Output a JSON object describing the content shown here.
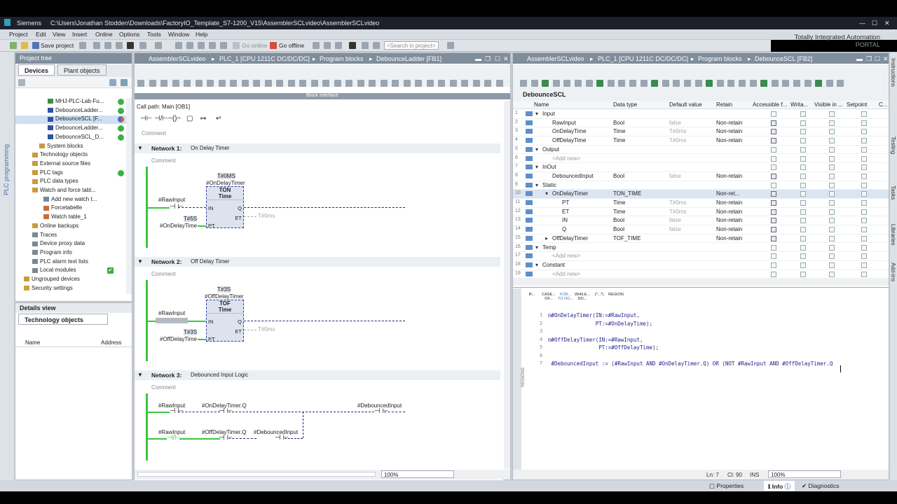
{
  "window": {
    "app": "Siemens",
    "path": "C:\\Users\\Jonathan Stodden\\Downloads\\FactoryIO_Template_S7-1200_V15\\AssemblerSCLvideo\\AssemblerSCLvideo"
  },
  "menu": [
    "Project",
    "Edit",
    "View",
    "Insert",
    "Online",
    "Options",
    "Tools",
    "Window",
    "Help"
  ],
  "toolbar": {
    "save": "Save project",
    "go_online": "Go online",
    "go_offline": "Go offline",
    "search_placeholder": "<Search in project>"
  },
  "brand": {
    "line1": "Totally Integrated Automation",
    "line2": "PORTAL"
  },
  "sidebar_left": "PLC programming",
  "project_tree": {
    "title": "Project tree",
    "tabs": [
      "Devices",
      "Plant objects"
    ],
    "items": [
      {
        "label": "MHJ-PLC-Lab-Fu...",
        "status": "green"
      },
      {
        "label": "DebounceLadder...",
        "status": "green"
      },
      {
        "label": "DebounceSCL [F...",
        "status": "half"
      },
      {
        "label": "DebounceLadder...",
        "status": "green"
      },
      {
        "label": "DebounceSCL_D...",
        "status": "green"
      },
      {
        "label": "System blocks",
        "status": ""
      },
      {
        "label": "Technology objects",
        "status": ""
      },
      {
        "label": "External source files",
        "status": ""
      },
      {
        "label": "PLC tags",
        "status": "green"
      },
      {
        "label": "PLC data types",
        "status": ""
      },
      {
        "label": "Watch and force tabl...",
        "status": ""
      },
      {
        "label": "Add new watch t...",
        "status": ""
      },
      {
        "label": "Forcetabelle",
        "status": ""
      },
      {
        "label": "Watch table_1",
        "status": ""
      },
      {
        "label": "Online backups",
        "status": ""
      },
      {
        "label": "Traces",
        "status": ""
      },
      {
        "label": "Device proxy data",
        "status": ""
      },
      {
        "label": "Program info",
        "status": ""
      },
      {
        "label": "PLC alarm text lists",
        "status": ""
      },
      {
        "label": "Local modules",
        "status": "check"
      },
      {
        "label": "Ungrouped devices",
        "status": ""
      },
      {
        "label": "Security settings",
        "status": ""
      }
    ]
  },
  "details": {
    "title": "Details view",
    "tab": "Technology objects",
    "col_name": "Name",
    "col_address": "Address"
  },
  "ladder": {
    "breadcrumb": [
      "AssemblerSCLvideo",
      "PLC_1 [CPU 1211C DC/DC/DC]",
      "Program blocks",
      "DebounceLadder [FB1]"
    ],
    "block_interface": "Block interface",
    "call_path": "Call path: Main [OB1]",
    "comment": "Comment",
    "networks": [
      {
        "title": "Network 1:",
        "desc": "On Delay Timer",
        "timer_value": "T#0MS",
        "timer_name": "#OnDelayTimer",
        "type": "TON",
        "sub": "Time",
        "in_contact": "#RawInput",
        "pt_value": "T#5S",
        "pt_tag": "#OnDelayTime",
        "et": "T#0ms",
        "pins": [
          "IN",
          "Q",
          "PT",
          "ET"
        ]
      },
      {
        "title": "Network 2:",
        "desc": "Off Delay Timer",
        "timer_value": "T#3S",
        "timer_name": "#OffDelayTimer",
        "type": "TOF",
        "sub": "Time",
        "in_contact": "#RawInput",
        "pt_value": "T#3S",
        "pt_tag": "#OffDelayTime",
        "et": "T#0ms",
        "pins": [
          "IN",
          "Q",
          "PT",
          "ET"
        ]
      },
      {
        "title": "Network 3:",
        "desc": "Debounced Input Logic",
        "r1": [
          "#RawInput",
          "#OnDelayTimer.Q",
          "#DebouncedInput"
        ],
        "r2": [
          "#RawInput",
          "#OffDelayTimer.Q",
          "#DebouncedInput"
        ]
      }
    ],
    "zoom": "100%"
  },
  "scl": {
    "breadcrumb": [
      "AssemblerSCLvideo",
      "PLC_1 [CPU 1211C DC/DC/DC]",
      "Program blocks",
      "DebounceSCL [FB2]"
    ],
    "block": "DebounceSCL",
    "columns": [
      "Name",
      "Data type",
      "Default value",
      "Retain",
      "Accessible f...",
      "Writa...",
      "Visible in ...",
      "Setpoint",
      "C..."
    ],
    "rows": [
      {
        "n": "1",
        "name": "Input",
        "type": "",
        "def": "",
        "ret": "",
        "lvl": 0,
        "grp": true
      },
      {
        "n": "2",
        "name": "RawInput",
        "type": "Bool",
        "def": "false",
        "ret": "Non-retain",
        "lvl": 1
      },
      {
        "n": "3",
        "name": "OnDelayTime",
        "type": "Time",
        "def": "T#0ms",
        "ret": "Non-retain",
        "lvl": 1
      },
      {
        "n": "4",
        "name": "OffDelayTime",
        "type": "Time",
        "def": "T#0ms",
        "ret": "Non-retain",
        "lvl": 1
      },
      {
        "n": "5",
        "name": "Output",
        "type": "",
        "def": "",
        "ret": "",
        "lvl": 0,
        "grp": true
      },
      {
        "n": "6",
        "name": "<Add new>",
        "type": "",
        "def": "",
        "ret": "",
        "lvl": 1,
        "add": true
      },
      {
        "n": "7",
        "name": "InOut",
        "type": "",
        "def": "",
        "ret": "",
        "lvl": 0,
        "grp": true
      },
      {
        "n": "8",
        "name": "DebouncedInput",
        "type": "Bool",
        "def": "false",
        "ret": "Non-retain",
        "lvl": 1
      },
      {
        "n": "9",
        "name": "Static",
        "type": "",
        "def": "",
        "ret": "",
        "lvl": 0,
        "grp": true
      },
      {
        "n": "10",
        "name": "OnDelayTimer",
        "type": "TON_TIME",
        "def": "",
        "ret": "Non-ret...",
        "lvl": 1,
        "sel": true
      },
      {
        "n": "11",
        "name": "PT",
        "type": "Time",
        "def": "T#0ms",
        "ret": "Non-retain",
        "lvl": 2
      },
      {
        "n": "12",
        "name": "ET",
        "type": "Time",
        "def": "T#0ms",
        "ret": "Non-retain",
        "lvl": 2
      },
      {
        "n": "13",
        "name": "IN",
        "type": "Bool",
        "def": "false",
        "ret": "Non-retain",
        "lvl": 2
      },
      {
        "n": "14",
        "name": "Q",
        "type": "Bool",
        "def": "false",
        "ret": "Non-retain",
        "lvl": 2
      },
      {
        "n": "15",
        "name": "OffDelayTimer",
        "type": "TOF_TIME",
        "def": "",
        "ret": "Non-retain",
        "lvl": 1
      },
      {
        "n": "16",
        "name": "Temp",
        "type": "",
        "def": "",
        "ret": "",
        "lvl": 0,
        "grp": true
      },
      {
        "n": "17",
        "name": "<Add new>",
        "type": "",
        "def": "",
        "ret": "",
        "lvl": 1,
        "add": true
      },
      {
        "n": "18",
        "name": "Constant",
        "type": "",
        "def": "",
        "ret": "",
        "lvl": 0,
        "grp": true
      },
      {
        "n": "19",
        "name": "<Add new>",
        "type": "",
        "def": "",
        "ret": "",
        "lvl": 1,
        "add": true
      }
    ],
    "instr_tabs": [
      "IF...",
      "CASE... OF...",
      "FOR... TO DO...",
      "WHILE... DO...",
      "(*...*)",
      "REGION"
    ],
    "code": [
      {
        "n": "1",
        "t": "⊟#OnDelayTimer(IN:=#RawInput,"
      },
      {
        "n": "2",
        "t": "               PT:=#OnDelayTime);"
      },
      {
        "n": "3",
        "t": ""
      },
      {
        "n": "4",
        "t": "⊟#OffDelayTimer(IN:=#RawInput,"
      },
      {
        "n": "5",
        "t": "                PT:=#OffDelayTime);"
      },
      {
        "n": "6",
        "t": ""
      },
      {
        "n": "7",
        "t": " #DebouncedInput := (#RawInput AND #OnDelayTimer.Q) OR (NOT #RawInput AND #OffDelayTimer.Q"
      }
    ],
    "regions": "REGIONS",
    "status": {
      "ln": "Ln: 7",
      "cl": "Cl: 90",
      "ins": "INS",
      "zoom": "100%"
    }
  },
  "right_strip": [
    "Instructions",
    "Testing",
    "Tasks",
    "Libraries",
    "Add-ins"
  ],
  "bottom": {
    "properties": "Properties",
    "info": "Info",
    "diagnostics": "Diagnostics"
  }
}
